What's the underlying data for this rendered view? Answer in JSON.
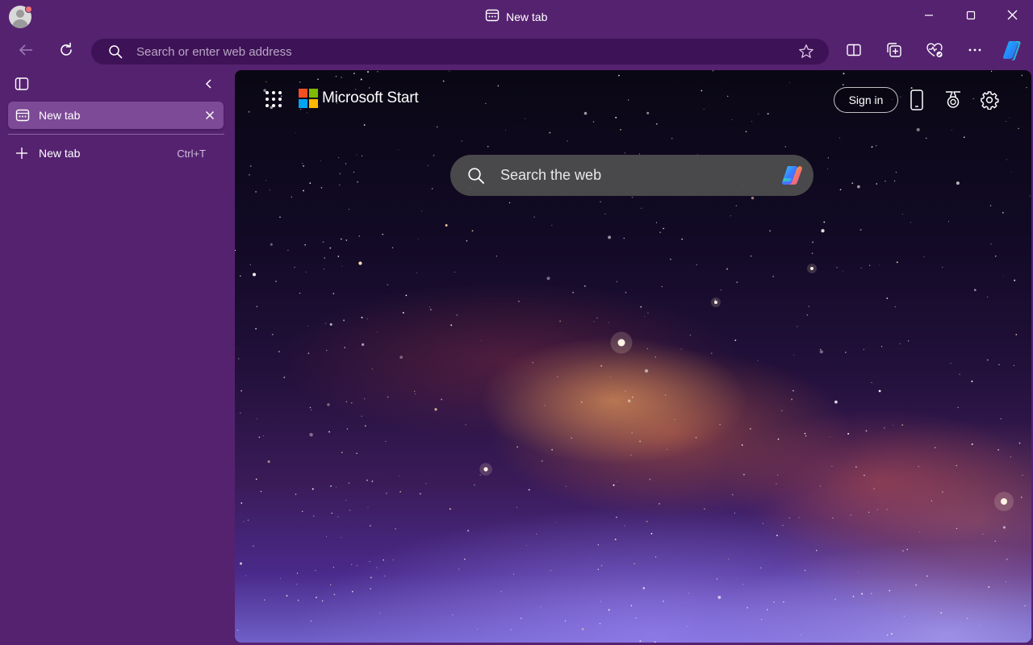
{
  "window": {
    "title": "New tab",
    "controls": [
      "minimize-icon",
      "maximize-icon",
      "close-icon"
    ]
  },
  "toolbar": {
    "address_placeholder": "Search or enter web address",
    "icons": [
      "back-icon",
      "refresh-icon",
      "search-icon",
      "favorite-star-icon",
      "split-screen-icon",
      "collections-icon",
      "browser-essentials-icon",
      "more-icon",
      "copilot-icon"
    ]
  },
  "sidebar": {
    "tabs": [
      {
        "label": "New tab",
        "active": true
      }
    ],
    "new_tab": {
      "label": "New tab",
      "shortcut": "Ctrl+T"
    }
  },
  "ntp": {
    "brand": "Microsoft Start",
    "sign_in": "Sign in",
    "search_placeholder": "Search the web"
  },
  "colors": {
    "frame": "#552270",
    "address_bar": "#3e1256",
    "active_tab": "#7c4a96",
    "ms_red": "#f25022",
    "ms_green": "#7fba00",
    "ms_blue": "#00a4ef",
    "ms_yellow": "#ffb900"
  }
}
